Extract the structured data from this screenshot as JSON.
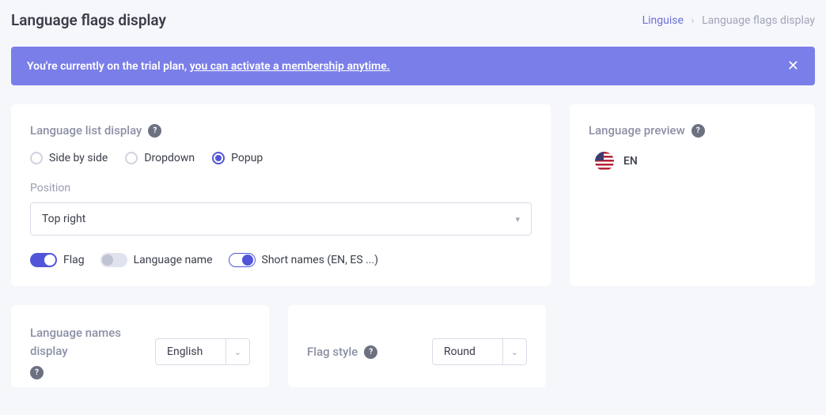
{
  "header": {
    "title": "Language flags display",
    "breadcrumb": {
      "link": "Linguise",
      "current": "Language flags display"
    }
  },
  "banner": {
    "text": "You're currently on the trial plan, ",
    "linkText": "you can activate a membership anytime."
  },
  "display": {
    "title": "Language list display",
    "options": {
      "side": "Side by side",
      "dropdown": "Dropdown",
      "popup": "Popup"
    },
    "positionLabel": "Position",
    "positionValue": "Top right",
    "toggles": {
      "flag": "Flag",
      "langName": "Language name",
      "shortNames": "Short names (EN, ES ...)"
    }
  },
  "preview": {
    "title": "Language preview",
    "code": "EN"
  },
  "namesDisplay": {
    "title": "Language names display",
    "value": "English"
  },
  "flagStyle": {
    "title": "Flag style",
    "value": "Round"
  }
}
